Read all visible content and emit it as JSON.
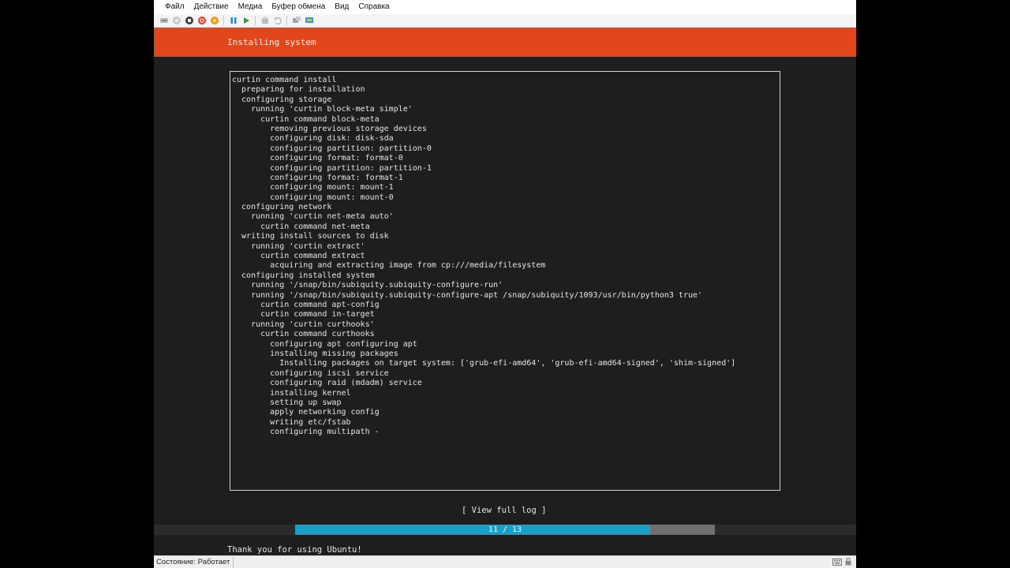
{
  "menu": [
    {
      "label": "Файл"
    },
    {
      "label": "Действие"
    },
    {
      "label": "Медиа"
    },
    {
      "label": "Буфер обмена"
    },
    {
      "label": "Вид"
    },
    {
      "label": "Справка"
    }
  ],
  "toolbar": {
    "icons": [
      "ctrl-alt-del-icon",
      "start-icon",
      "turn-off-icon",
      "shutdown-icon",
      "save-icon",
      "pause-icon",
      "resume-icon",
      "checkpoint-icon",
      "revert-icon",
      "share-icon",
      "enhanced-session-icon"
    ],
    "colors": {
      "shutdown": "#e0392c",
      "save": "#f29a1d",
      "pause": "#1e88e5",
      "resume": "#2e9d3a"
    }
  },
  "header": {
    "title": "Installing system",
    "color": "#e2461d"
  },
  "log": {
    "lines": [
      "curtin command install",
      "  preparing for installation",
      "  configuring storage",
      "    running 'curtin block-meta simple'",
      "      curtin command block-meta",
      "        removing previous storage devices",
      "        configuring disk: disk-sda",
      "        configuring partition: partition-0",
      "        configuring format: format-0",
      "        configuring partition: partition-1",
      "        configuring format: format-1",
      "        configuring mount: mount-1",
      "        configuring mount: mount-0",
      "  configuring network",
      "    running 'curtin net-meta auto'",
      "      curtin command net-meta",
      "  writing install sources to disk",
      "    running 'curtin extract'",
      "      curtin command extract",
      "        acquiring and extracting image from cp:///media/filesystem",
      "  configuring installed system",
      "    running '/snap/bin/subiquity.subiquity-configure-run'",
      "    running '/snap/bin/subiquity.subiquity-configure-apt /snap/subiquity/1093/usr/bin/python3 true'",
      "      curtin command apt-config",
      "      curtin command in-target",
      "    running 'curtin curthooks'",
      "      curtin command curthooks",
      "        configuring apt configuring apt",
      "        installing missing packages",
      "          Installing packages on target system: ['grub-efi-amd64', 'grub-efi-amd64-signed', 'shim-signed']",
      "        configuring iscsi service",
      "        configuring raid (mdadm) service",
      "        installing kernel",
      "        setting up swap",
      "        apply networking config",
      "        writing etc/fstab",
      "        configuring multipath -"
    ]
  },
  "view_log_label": "[ View full log ]",
  "progress": {
    "current": 11,
    "total": 13,
    "text": "11 / 13",
    "fill_color": "#19a0c9"
  },
  "footer_message": "Thank you for using Ubuntu!",
  "status": {
    "text": "Состояние: Работает"
  }
}
